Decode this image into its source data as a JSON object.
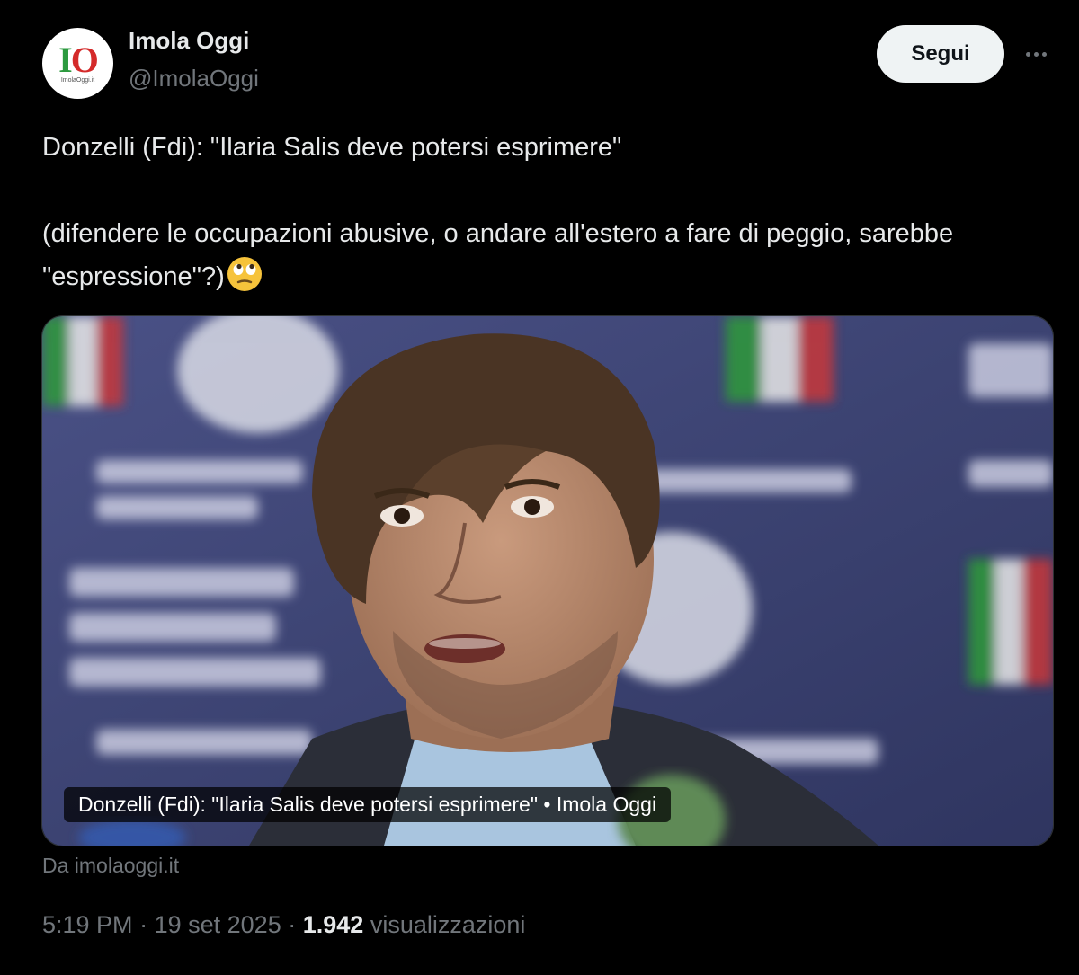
{
  "author": {
    "display_name": "Imola Oggi",
    "handle": "@ImolaOggi",
    "avatar_logo_text": "IO",
    "avatar_subtext": "ImolaOggi.it"
  },
  "actions": {
    "follow_label": "Segui",
    "more_icon": "more-horizontal-icon"
  },
  "tweet": {
    "line1": "Donzelli (Fdi): \"Ilaria Salis deve potersi esprimere\"",
    "line2": "(difendere le occupazioni abusive, o andare all'estero a fare di peggio, sarebbe \"espressione\"?)",
    "emoji": "face-with-rolling-eyes-icon"
  },
  "link_card": {
    "caption": "Donzelli (Fdi): \"Ilaria Salis deve potersi esprimere\" • Imola Oggi",
    "source": "Da imolaoggi.it"
  },
  "meta": {
    "time": "5:19 PM",
    "separator": "·",
    "date": "19 set 2025",
    "views_count": "1.942",
    "views_label": "visualizzazioni"
  },
  "colors": {
    "background": "#000000",
    "text_primary": "#e7e9ea",
    "text_secondary": "#71767b",
    "follow_button_bg": "#eff3f4",
    "backdrop_blue": "#3c4372"
  }
}
